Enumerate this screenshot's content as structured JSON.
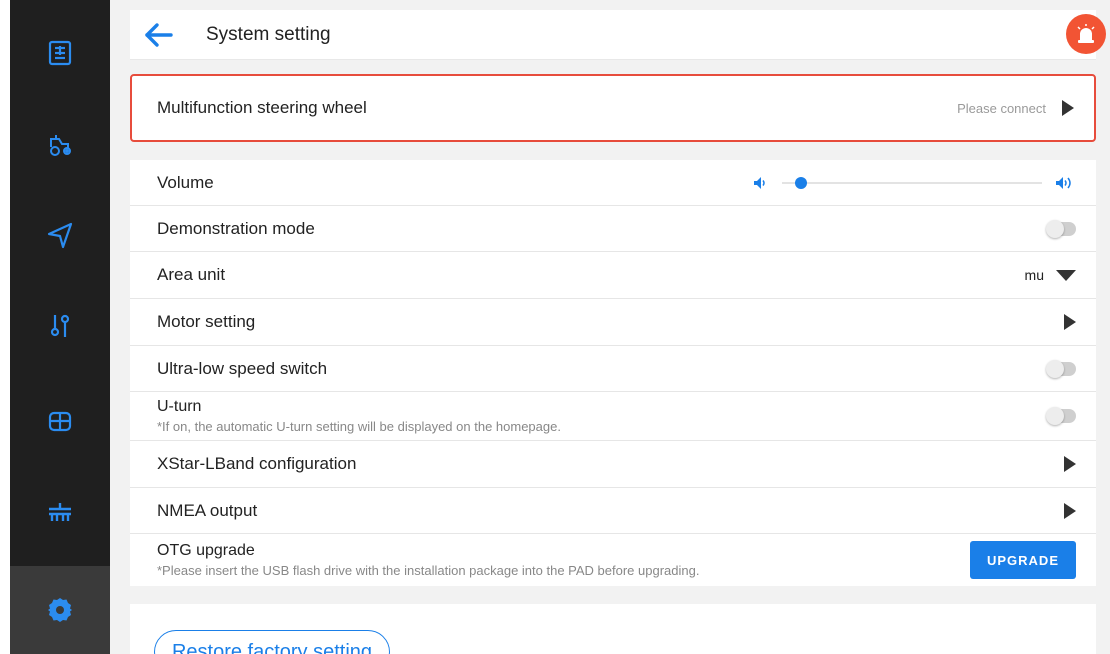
{
  "header": {
    "title": "System setting"
  },
  "wheel": {
    "label": "Multifunction steering wheel",
    "status": "Please connect"
  },
  "settings": {
    "volume": {
      "label": "Volume",
      "level": 0.05
    },
    "demo": {
      "label": "Demonstration mode",
      "on": false
    },
    "area_unit": {
      "label": "Area unit",
      "value": "mu"
    },
    "motor": {
      "label": "Motor setting"
    },
    "ultra_low": {
      "label": "Ultra-low speed switch",
      "on": false
    },
    "uturn": {
      "label": "U-turn",
      "sub": "*If on, the automatic U-turn setting will be displayed on the homepage.",
      "on": false
    },
    "xstar": {
      "label": "XStar-LBand configuration"
    },
    "nmea": {
      "label": "NMEA output"
    },
    "otg": {
      "label": "OTG upgrade",
      "sub": "*Please insert the USB flash drive with the installation package into the PAD before upgrading.",
      "button": "UPGRADE"
    }
  },
  "footer": {
    "restore_label": "Restore factory setting"
  },
  "colors": {
    "accent": "#1a7fe8",
    "alert": "#e74c3c",
    "rail": "#1f1f1f"
  },
  "icons": {
    "rail": [
      "task-list-icon",
      "tractor-icon",
      "navigation-icon",
      "sliders-icon",
      "field-grid-icon",
      "implement-icon",
      "gear-icon"
    ],
    "header": [
      "back-arrow-icon",
      "alarm-siren-icon"
    ]
  }
}
